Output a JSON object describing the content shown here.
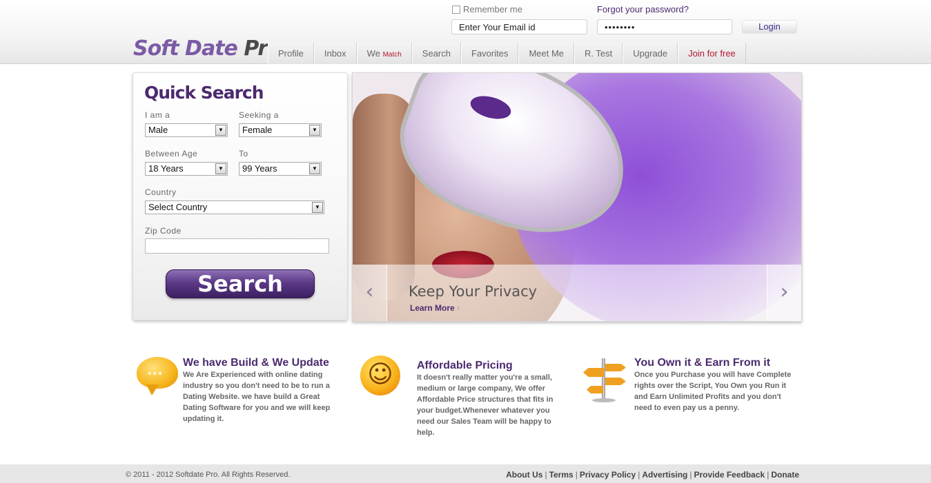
{
  "header": {
    "remember_label": "Remember me",
    "forgot_label": "Forgot your password?",
    "email_value": "Enter Your Email id",
    "password_value": "••••••••",
    "login_label": "Login",
    "logo_part1": "Soft Date",
    "logo_part2": "Pro"
  },
  "nav": {
    "items": [
      {
        "label": "Profile"
      },
      {
        "label": "Inbox"
      },
      {
        "label": "We",
        "sub": "Match"
      },
      {
        "label": "Search"
      },
      {
        "label": "Favorites"
      },
      {
        "label": "Meet Me"
      },
      {
        "label": "R. Test"
      },
      {
        "label": "Upgrade"
      },
      {
        "label": "Join for free"
      }
    ]
  },
  "quick_search": {
    "title": "Quick Search",
    "i_am_label": "I am a",
    "i_am_value": "Male",
    "seeking_label": "Seeking a",
    "seeking_value": "Female",
    "between_age_label": "Between Age",
    "age_from_value": "18 Years",
    "to_label": "To",
    "age_to_value": "99 Years",
    "country_label": "Country",
    "country_value": "Select Country",
    "zip_label": "Zip Code",
    "zip_value": "",
    "search_label": "Search"
  },
  "banner": {
    "heading": "Keep Your Privacy",
    "learn_more": "Learn More",
    "prev_icon": "‹",
    "next_icon": "›"
  },
  "features": [
    {
      "icon": "speech-bubble-icon",
      "title": "We have Build & We Update",
      "text": "We Are Experienced with online dating industry so you don't need to be to run a Dating Website. we have build a Great Dating Software for you and we will keep updating it."
    },
    {
      "icon": "smiley-icon",
      "title": "Affordable Pricing",
      "text": "It doesn't really matter you're a small, medium or large company, We offer Affordable Price structures that fits in your budget.Whenever whatever you need our Sales Team will be happy to help."
    },
    {
      "icon": "signpost-icon",
      "title": "You Own it & Earn From it",
      "text": "Once you Purchase you will have Complete rights over the Script, You Own you Run it and Earn Unlimited Profits and you don't need to even pay us a penny."
    }
  ],
  "footer": {
    "copyright": "© 2011 - 2012 Softdate Pro. All Rights Reserved.",
    "links": [
      "About Us",
      "Terms",
      "Privacy Policy",
      "Advertising",
      "Provide Feedback",
      "Donate"
    ]
  },
  "colors": {
    "brand_purple": "#4b2a6e",
    "logo_purple": "#7b5aa6",
    "join_red": "#b0172e"
  }
}
